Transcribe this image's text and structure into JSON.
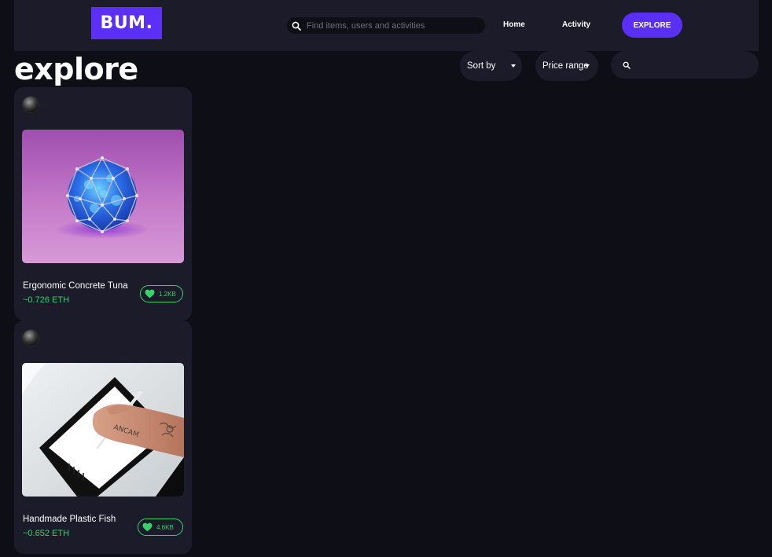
{
  "header": {
    "logo": "BUM.",
    "search_placeholder": "Find items, users and activities",
    "nav": {
      "home": "Home",
      "activity": "Activity",
      "explore": "EXPLORE"
    }
  },
  "page": {
    "title": "explore",
    "filters": {
      "sort_by": "Sort by",
      "price_range": "Price range",
      "search_placeholder": ""
    }
  },
  "cards": [
    {
      "name": "Ergonomic Concrete Tuna",
      "price": "~0.726 ETH",
      "likes": "1.2KB",
      "image": "blue-crystal-sphere"
    },
    {
      "name": "Handmade Plastic Fish",
      "price": "~0.652 ETH",
      "likes": "4.6KB",
      "image": "hand-drawing-on-tablet"
    }
  ],
  "colors": {
    "accent": "#5b2ff5",
    "background": "#0e0e17",
    "surface": "#1b1b2a",
    "price": "#35d36a"
  }
}
